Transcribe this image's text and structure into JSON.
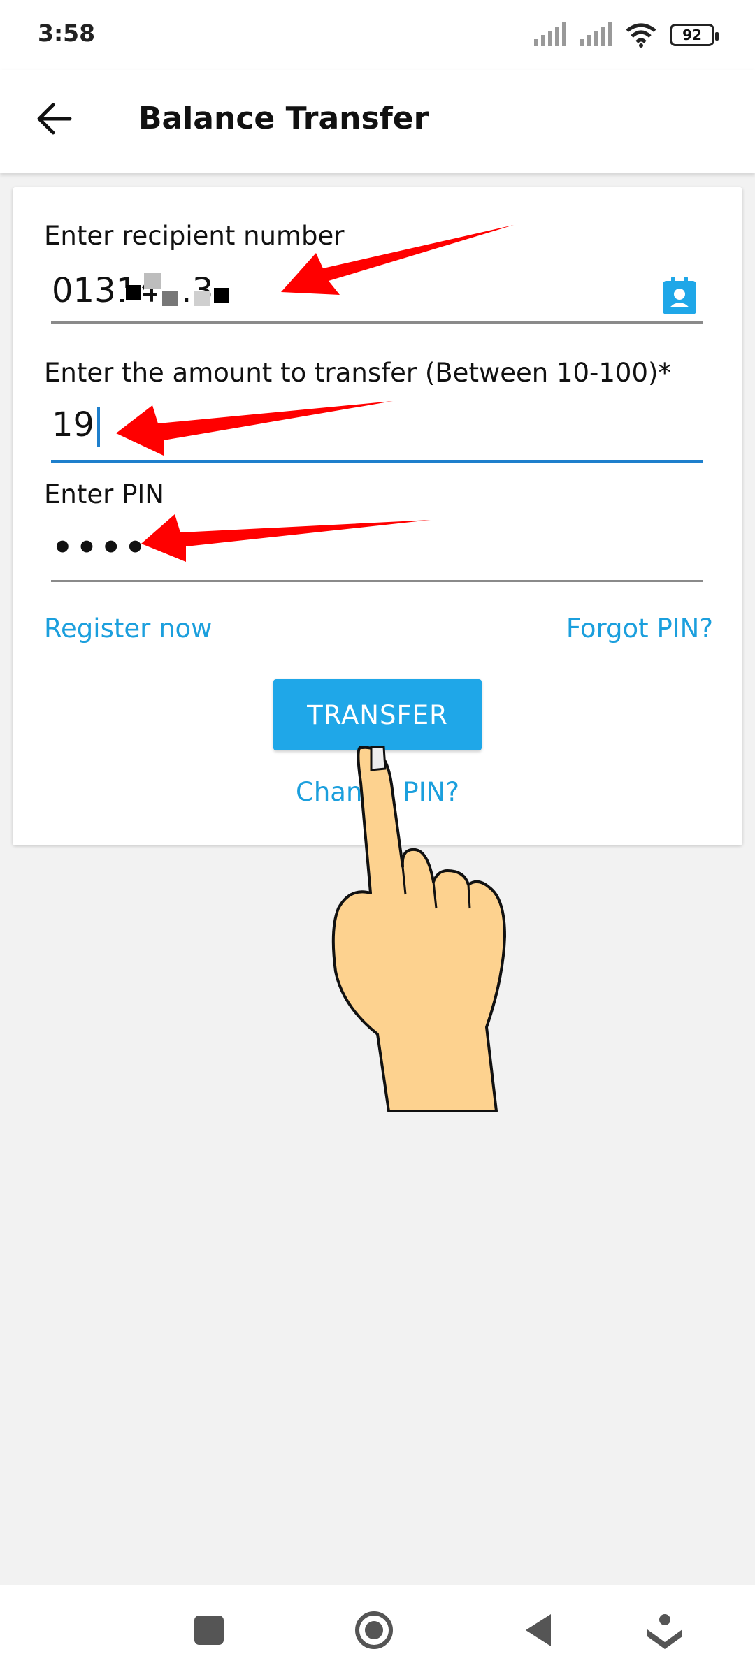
{
  "status_bar": {
    "time": "3:58",
    "battery": "92"
  },
  "app_bar": {
    "title": "Balance Transfer",
    "back_icon": "arrow-left-icon"
  },
  "form": {
    "recipient": {
      "label": "Enter recipient number",
      "value": "01314…3",
      "contact_icon": "contact-book-icon"
    },
    "amount": {
      "label": "Enter the amount to transfer (Between 10-100)*",
      "value": "19"
    },
    "pin": {
      "label": "Enter PIN",
      "value": "••••"
    }
  },
  "links": {
    "register": "Register now",
    "forgot_pin": "Forgot PIN?",
    "change_pin": "Change PIN?"
  },
  "transfer_button": {
    "label": "TRANSFER"
  },
  "colors": {
    "accent": "#1fa7e8",
    "link": "#1b9fdd",
    "active_underline": "#1e7fcc",
    "annotation_arrow": "#ff0000",
    "hand": "#fdd28f"
  },
  "nav_bar": {
    "icons": [
      "recents-square-icon",
      "home-circle-icon",
      "back-triangle-icon",
      "assistant-icon"
    ]
  }
}
